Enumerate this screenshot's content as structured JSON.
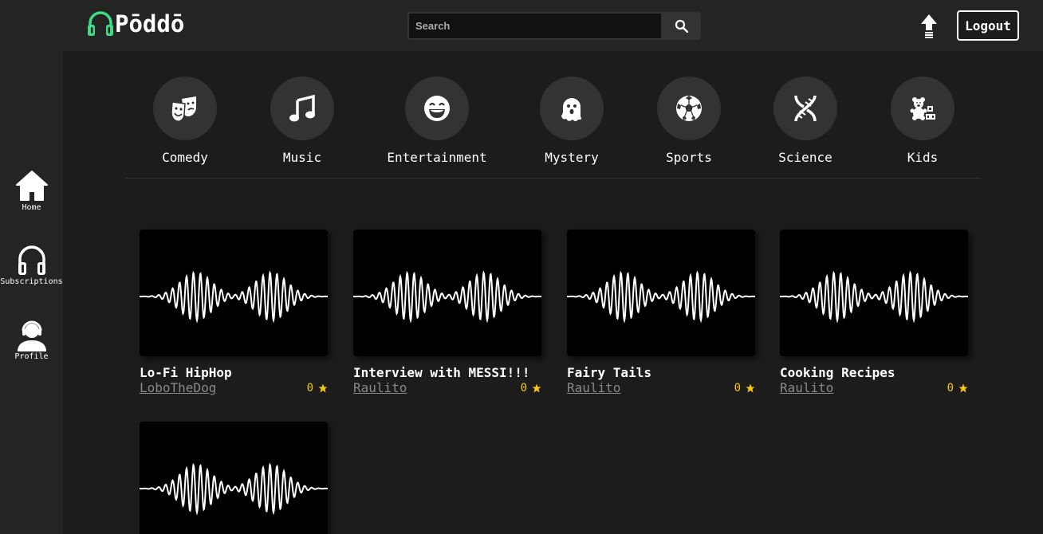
{
  "app": {
    "name": "Pōddō"
  },
  "sidebar": {
    "items": [
      {
        "label": "Home",
        "icon": "home-icon"
      },
      {
        "label": "Subscriptions",
        "icon": "headphones-icon"
      },
      {
        "label": "Profile",
        "icon": "user-headset-icon"
      }
    ]
  },
  "header": {
    "search_placeholder": "Search",
    "logout_label": "Logout"
  },
  "categories": [
    {
      "label": "Comedy",
      "icon": "theater-masks-icon"
    },
    {
      "label": "Music",
      "icon": "music-note-icon"
    },
    {
      "label": "Entertainment",
      "icon": "laugh-icon"
    },
    {
      "label": "Mystery",
      "icon": "ghost-icon"
    },
    {
      "label": "Sports",
      "icon": "soccer-ball-icon"
    },
    {
      "label": "Science",
      "icon": "dna-icon"
    },
    {
      "label": "Kids",
      "icon": "teddy-bear-icon"
    }
  ],
  "podcasts": [
    {
      "title": "Lo-Fi HipHop",
      "author": "LoboTheDog",
      "rating": "0"
    },
    {
      "title": "Interview with MESSI!!!",
      "author": "Raulito",
      "rating": "0"
    },
    {
      "title": "Fairy Tails",
      "author": "Raulito",
      "rating": "0"
    },
    {
      "title": "Cooking Recipes",
      "author": "Raulito",
      "rating": "0"
    },
    {
      "title": "",
      "author": "",
      "rating": ""
    }
  ],
  "colors": {
    "background": "#1c1c1c",
    "panel": "#242424",
    "accent_green": "#3ddc84",
    "star": "#f5c518"
  }
}
